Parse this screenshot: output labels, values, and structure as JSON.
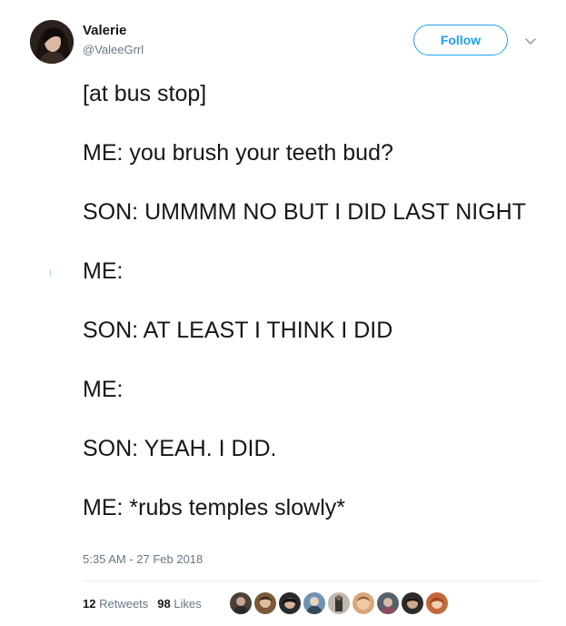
{
  "author": {
    "name": "Valerie",
    "handle": "@ValeeGrrl"
  },
  "header": {
    "follow_label": "Follow",
    "accent_color": "#1da1f2"
  },
  "tweet": {
    "lines": [
      "[at bus stop]",
      "ME: you brush your teeth bud?",
      "SON: UMMMM NO BUT I DID LAST NIGHT",
      "ME:",
      "SON: AT LEAST I THINK I DID",
      "ME:",
      "SON: YEAH. I DID.",
      "ME: *rubs temples slowly*"
    ],
    "timestamp": "5:35 AM - 27 Feb 2018"
  },
  "stats": {
    "retweets_count": "12",
    "retweets_label": "Retweets",
    "likes_count": "98",
    "likes_label": "Likes"
  },
  "likers": [
    {
      "icon": "liker-avatar-1"
    },
    {
      "icon": "liker-avatar-2"
    },
    {
      "icon": "liker-avatar-3"
    },
    {
      "icon": "liker-avatar-4"
    },
    {
      "icon": "liker-avatar-5"
    },
    {
      "icon": "liker-avatar-6"
    },
    {
      "icon": "liker-avatar-7"
    },
    {
      "icon": "liker-avatar-8"
    },
    {
      "icon": "liker-avatar-9"
    }
  ]
}
